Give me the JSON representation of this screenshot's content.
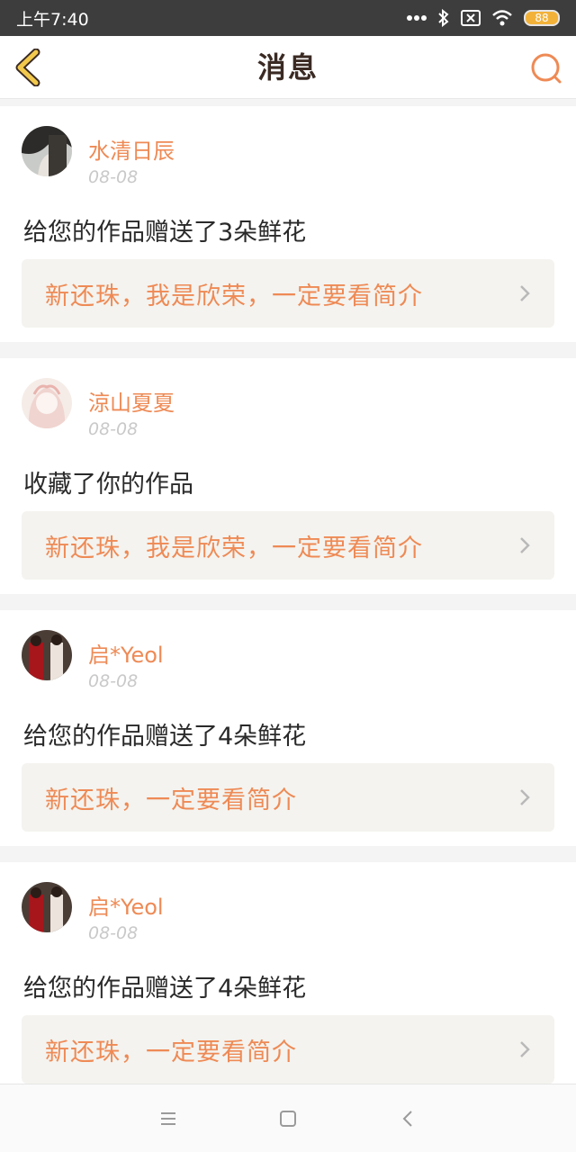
{
  "status_bar": {
    "time": "上午7:40",
    "battery": "88",
    "icons": [
      "more-dots-icon",
      "bluetooth-icon",
      "sim-off-icon",
      "wifi-icon",
      "battery-icon"
    ]
  },
  "header": {
    "title": "消息",
    "back_icon": "back-chevron-icon",
    "search_icon": "search-icon"
  },
  "colors": {
    "accent": "#ee8a55",
    "back_icon": "#f2c94c",
    "status_bar_bg": "#3d3d3d"
  },
  "notifications": [
    {
      "username": "水清日辰",
      "date": "08-08",
      "action": "给您的作品赠送了3朵鲜花",
      "work_title": "新还珠，我是欣荣，一定要看简介"
    },
    {
      "username": "涼山夏夏",
      "date": "08-08",
      "action": "收藏了你的作品",
      "work_title": "新还珠，我是欣荣，一定要看简介"
    },
    {
      "username": "启*Yeol",
      "date": "08-08",
      "action": "给您的作品赠送了4朵鲜花",
      "work_title": "新还珠，一定要看简介"
    },
    {
      "username": "启*Yeol",
      "date": "08-08",
      "action": "给您的作品赠送了4朵鲜花",
      "work_title": "新还珠，一定要看简介"
    }
  ],
  "system_nav": [
    "menu-icon",
    "home-icon",
    "back-icon"
  ]
}
